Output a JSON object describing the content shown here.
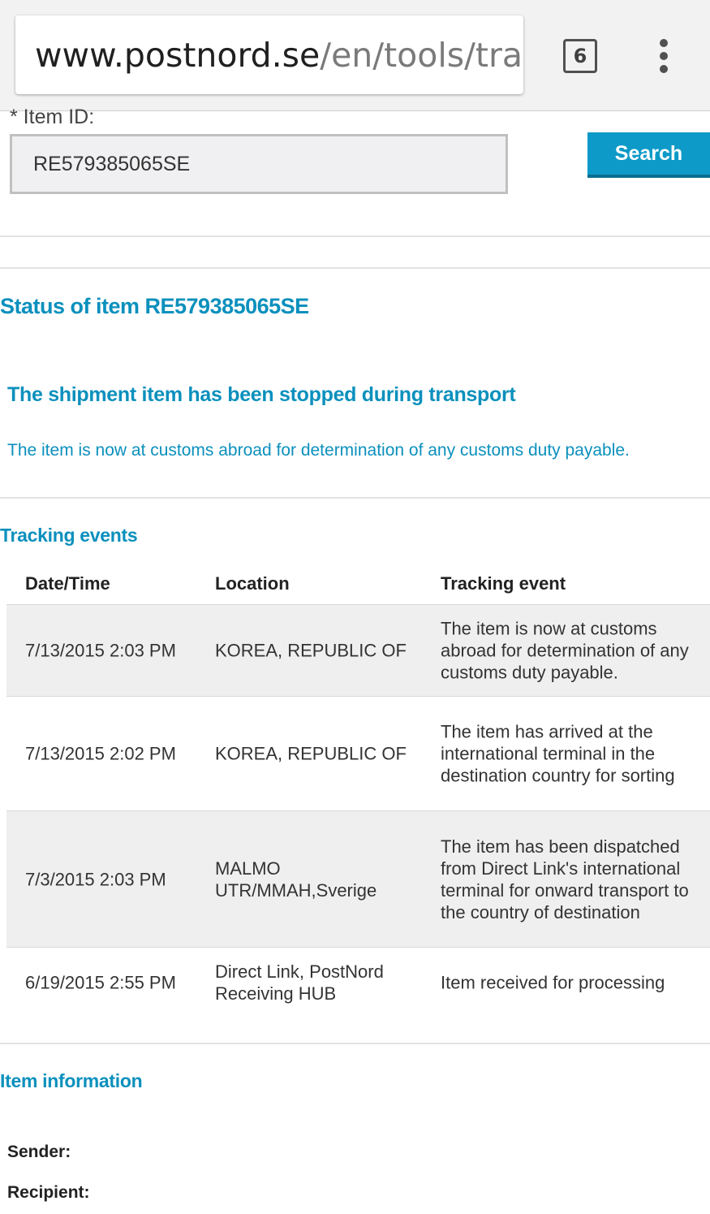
{
  "browser": {
    "url_domain": "www.postnord.se",
    "url_path": "/en/tools/trac",
    "tab_count": "6"
  },
  "form": {
    "item_id_label": "* Item ID:",
    "item_id_value": "RE579385065SE",
    "search_label": "Search"
  },
  "status": {
    "title": "Status of item RE579385065SE",
    "heading": "The shipment item has been stopped during transport",
    "description": "The item is now at customs abroad for determination of any customs duty payable."
  },
  "tracking": {
    "title": "Tracking events",
    "headers": [
      "Date/Time",
      "Location",
      "Tracking event"
    ],
    "rows": [
      {
        "datetime": "7/13/2015 2:03 PM",
        "location": "KOREA, REPUBLIC OF",
        "event": "The item is now at customs abroad for determination of any customs duty payable."
      },
      {
        "datetime": "7/13/2015 2:02 PM",
        "location": "KOREA, REPUBLIC OF",
        "event": "The item has arrived at the international terminal in the destination country for sorting"
      },
      {
        "datetime": "7/3/2015 2:03 PM",
        "location": "MALMO UTR/MMAH,Sverige",
        "event": "The item has been dispatched from Direct Link's international terminal for onward transport to the country of destination"
      },
      {
        "datetime": "6/19/2015 2:55 PM",
        "location": "Direct Link, PostNord Receiving HUB",
        "event": "Item received for processing"
      }
    ]
  },
  "item_info": {
    "title": "Item information",
    "sender_label": "Sender:",
    "recipient_label": "Recipient:"
  },
  "colors": {
    "accent": "#0b90bd",
    "button": "#0d9ac8",
    "row_shade": "#efefef"
  }
}
